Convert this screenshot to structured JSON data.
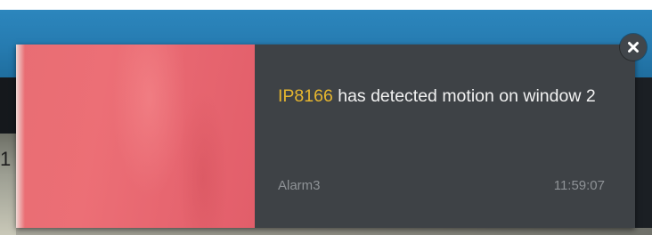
{
  "notification": {
    "camera_name": "IP8166",
    "message_rest": " has detected motion on window 2",
    "source": "Alarm3",
    "time": "11:59:07",
    "snapshot_alt": "Snapshot"
  },
  "close_button": {
    "icon": "close-icon",
    "label": "Close"
  },
  "background": {
    "left_glyph": "1"
  },
  "colors": {
    "header_blue": "#267bb0",
    "panel": "#3e4246",
    "camera_name_accent": "#e6b62f",
    "meta_text": "#8e9296",
    "snapshot": "#e86d73"
  }
}
